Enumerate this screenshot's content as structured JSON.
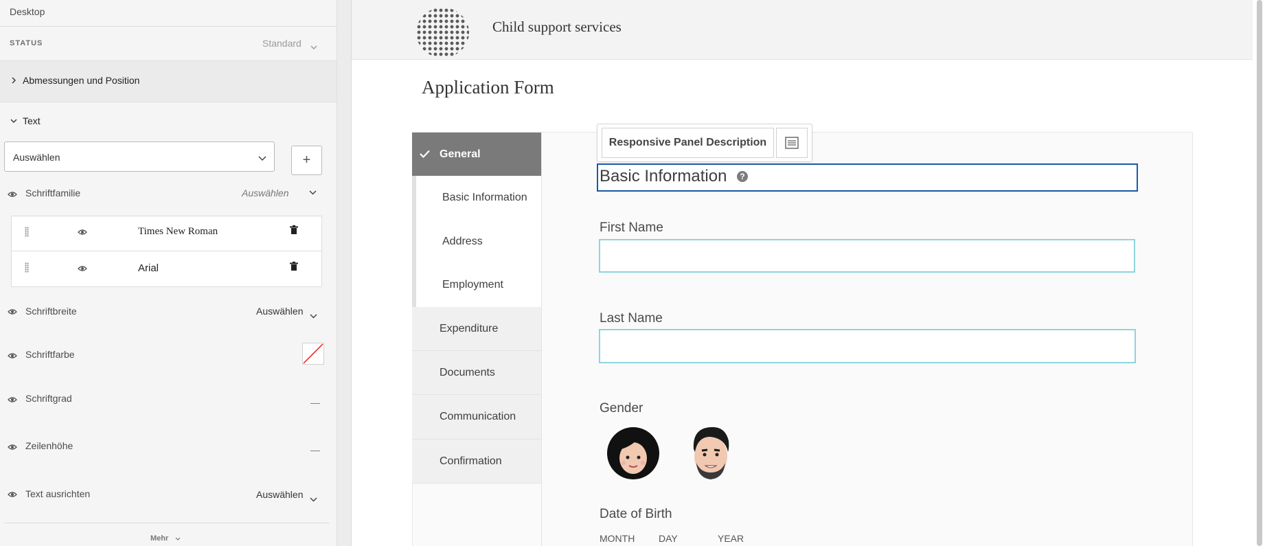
{
  "left_panel": {
    "device": "Desktop",
    "status_label": "STATUS",
    "status_value": "Standard",
    "section_dimensions": "Abmessungen und Position",
    "section_text": "Text",
    "select_placeholder": "Auswählen",
    "add_button": "+",
    "font_family_label": "Schriftfamilie",
    "font_family_value": "Auswählen",
    "fonts": [
      {
        "name": "Times New Roman"
      },
      {
        "name": "Arial"
      }
    ],
    "font_weight_label": "Schriftbreite",
    "font_weight_value": "Auswählen",
    "font_color_label": "Schriftfarbe",
    "font_size_label": "Schriftgrad",
    "font_size_value": "—",
    "line_height_label": "Zeilenhöhe",
    "line_height_value": "—",
    "text_align_label": "Text ausrichten",
    "text_align_value": "Auswählen",
    "more": "Mehr"
  },
  "app": {
    "site_title": "Child support services",
    "form_title": "Application Form",
    "nav": {
      "active": "General",
      "subitems": [
        "Basic Information",
        "Address",
        "Employment"
      ],
      "items": [
        "Expenditure",
        "Documents",
        "Communication",
        "Confirmation"
      ]
    },
    "toolbar": {
      "panel_description": "Responsive Panel Description"
    },
    "panel_title": "Basic Information",
    "help_icon_glyph": "?",
    "fields": {
      "first_name": {
        "label": "First Name",
        "value": ""
      },
      "last_name": {
        "label": "Last Name",
        "value": ""
      },
      "gender": {
        "label": "Gender"
      },
      "dob": {
        "label": "Date of Birth",
        "month": "MONTH",
        "day": "DAY",
        "year": "YEAR"
      }
    }
  },
  "colors": {
    "accent_blue": "#1a5aa6",
    "field_border": "#8fd3dd",
    "nav_active_bg": "#7a7a7a"
  }
}
